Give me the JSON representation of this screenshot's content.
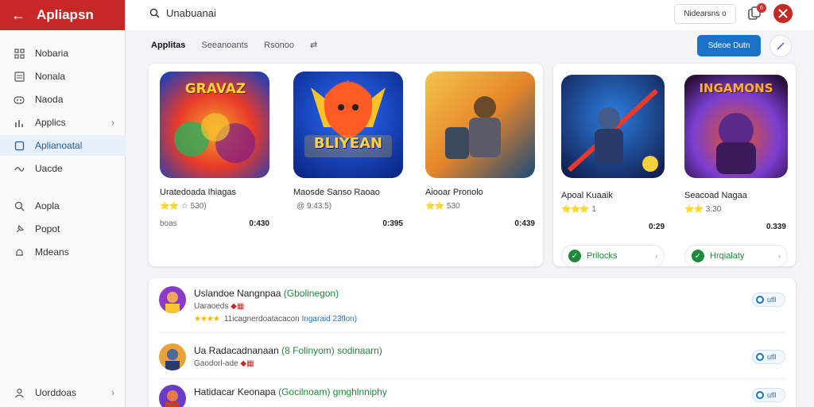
{
  "app": {
    "title": "Apliapsn"
  },
  "search": {
    "value": "Unabuanai"
  },
  "topbar": {
    "notifications_label": "Nidearsns o",
    "badge_count": "6"
  },
  "sidebar": {
    "items": [
      {
        "label": "Nobaria",
        "icon": "grid-icon"
      },
      {
        "label": "Nonala",
        "icon": "list-icon"
      },
      {
        "label": "Naoda",
        "icon": "gamepad-icon"
      },
      {
        "label": "Applics",
        "icon": "chart-icon",
        "chevron": true
      },
      {
        "label": "Aplianoatal",
        "icon": "square-icon",
        "active": true
      },
      {
        "label": "Uacde",
        "icon": "wave-icon"
      },
      {
        "label": "Aopla",
        "icon": "search-icon"
      },
      {
        "label": "Popot",
        "icon": "pin-icon"
      },
      {
        "label": "Mdeans",
        "icon": "bell-icon"
      },
      {
        "label": "Uorddoas",
        "icon": "user-icon",
        "chevron": true
      }
    ]
  },
  "tabs": [
    {
      "label": "Applitas",
      "active": true
    },
    {
      "label": "Seeanoants"
    },
    {
      "label": "Rsonoo"
    },
    {
      "label": "⇄"
    }
  ],
  "actions": {
    "primary_label": "Sdeoe Dutn"
  },
  "games": [
    {
      "name": "Uratedoada Ihiagas",
      "rating_text": "☆ 530)",
      "stars": "⭐⭐",
      "foot_left": "boas",
      "price": "0:430",
      "art_text": "GRAVAZ",
      "colors": [
        "#1f3fb8",
        "#e83a2a",
        "#f7c531"
      ]
    },
    {
      "name": "Maosde Sanso Raoao",
      "rating_text": "@ 9:43:5)",
      "stars": "",
      "foot_left": "",
      "price": "0:395",
      "art_text": "BLIYEAN",
      "colors": [
        "#0c2a8a",
        "#ff5b24",
        "#f9c12a"
      ]
    },
    {
      "name": "Aiooar Pronolo",
      "rating_text": "530",
      "stars": "⭐⭐",
      "foot_left": "",
      "price": "0:439",
      "art_text": "",
      "colors": [
        "#1a4a7a",
        "#e6862a",
        "#f3c54a"
      ]
    },
    {
      "name": "Apoal Kuaaik",
      "rating_text": "1",
      "stars": "⭐⭐⭐",
      "foot_left": "",
      "price": "0:29",
      "art_text": "",
      "colors": [
        "#121a4a",
        "#e83a2a",
        "#2b7fe0"
      ],
      "install_label": "Prilocks"
    },
    {
      "name": "Seacoad Nagaa",
      "rating_text": "3:30",
      "stars": "⭐⭐",
      "foot_left": "",
      "price": "0.339",
      "art_text": "INGAMONS",
      "colors": [
        "#2a0f3a",
        "#e8521f",
        "#7a3ed0"
      ],
      "install_label": "Hrqialaty"
    }
  ],
  "reviews": [
    {
      "title": "Uslandoe Nangnpaa",
      "tag": "(Gbolinegon)",
      "sub": "Uaraoeds",
      "stars": "★★★★",
      "meta": "11icagnerdoatacacon",
      "link": "Ingaraid 23flon)",
      "btn": "ufll"
    },
    {
      "title": "Ua Radacadnanaan",
      "tag": "(8 Folinyom) sodinaarn)",
      "sub": "Gaodorl-ade",
      "stars": "",
      "meta": "",
      "link": "",
      "btn": "ufll"
    },
    {
      "title": "Hatidacar Keonapa",
      "tag": "(Gocilnoam) gmghlnniphy",
      "sub": "",
      "stars": "",
      "meta": "",
      "link": "",
      "btn": "ufll"
    }
  ]
}
